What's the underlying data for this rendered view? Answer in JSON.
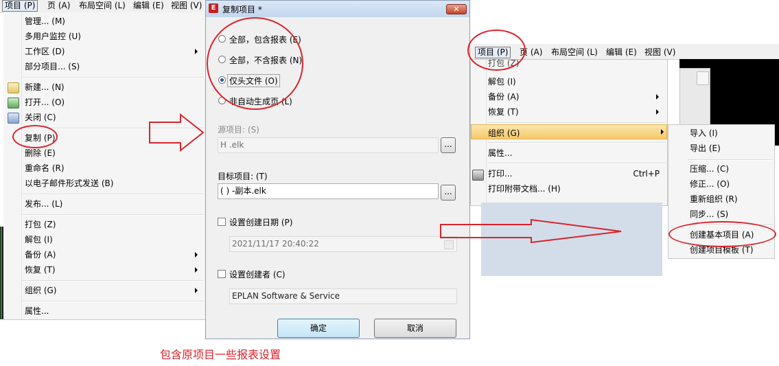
{
  "left_menu": {
    "menubar": [
      "项目 (P)",
      "页 (A)",
      "布局空间 (L)",
      "编辑 (E)",
      "视图 (V)"
    ],
    "items": [
      {
        "label": "管理... (M)"
      },
      {
        "label": "多用户监控 (U)"
      },
      {
        "label": "工作区 (D)"
      },
      {
        "label": "部分项目... (S)"
      },
      {
        "label": "新建... (N)",
        "icon": "new-project-icon"
      },
      {
        "label": "打开... (O)",
        "icon": "open-project-icon"
      },
      {
        "label": "关闭 (C)",
        "icon": "close-project-icon"
      },
      {
        "label": "复制 (P)"
      },
      {
        "label": "删除 (E)"
      },
      {
        "label": "重命名 (R)"
      },
      {
        "label": "以电子邮件形式发送 (B)"
      },
      {
        "label": "发布... (L)"
      },
      {
        "label": "打包 (Z)"
      },
      {
        "label": "解包 (I)"
      },
      {
        "label": "备份 (A)"
      },
      {
        "label": "恢复 (T)"
      },
      {
        "label": "组织 (G)"
      },
      {
        "label": "属性..."
      }
    ]
  },
  "dialog": {
    "title": "复制项目 *",
    "logo": "EPLAN logo",
    "close_label": "✕",
    "radios": [
      {
        "label": "全部，包含报表 (E)"
      },
      {
        "label": "全部，不含报表 (N)"
      },
      {
        "label": "仅头文件 (O)"
      },
      {
        "label": "非自动生成页 (L)"
      }
    ],
    "source_label": "源项目: (S)",
    "source_value": "H                    .elk",
    "browse_label": "...",
    "target_label": "目标项目: (T)",
    "target_value": "          (    )        -副本.elk",
    "set_date_label": "设置创建日期 (P)",
    "date_value": "2021/11/17 20:40:22",
    "set_creator_label": "设置创建者 (C)",
    "creator_value": "EPLAN Software & Service",
    "ok_label": "确定",
    "cancel_label": "取消"
  },
  "right_menu": {
    "menubar": [
      "项目 (P)",
      "页 (A)",
      "布局空间 (L)",
      "编辑 (E)",
      "视图 (V)"
    ],
    "items": [
      {
        "label": "打包 (Z)"
      },
      {
        "label": "解包 (I)"
      },
      {
        "label": "备份 (A)"
      },
      {
        "label": "恢复 (T)"
      },
      {
        "label": "组织 (G)"
      },
      {
        "label": "属性..."
      },
      {
        "label": "打印...",
        "shortcut": "Ctrl+P"
      },
      {
        "label": "打印附带文档... (H)"
      }
    ],
    "submenu": [
      "导入 (I)",
      "导出 (E)",
      "压缩... (C)",
      "修正... (O)",
      "重新组织 (R)",
      "同步... (S)",
      "创建基本项目 (A)",
      "创建项目模板 (T)"
    ]
  },
  "caption": "包含原项目一些报表设置",
  "colors": {
    "annotation": "#d9232b",
    "highlight": "#f5c96a",
    "radio_dot": "#1e5aa8"
  }
}
